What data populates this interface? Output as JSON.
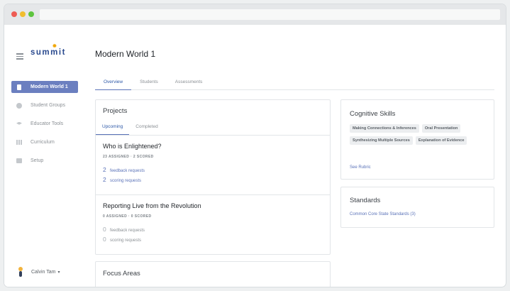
{
  "app": {
    "logo_text": "summit"
  },
  "sidebar": {
    "items": [
      {
        "label": "Modern World 1",
        "icon": "book-icon",
        "active": true
      },
      {
        "label": "Student Groups",
        "icon": "person-icon",
        "active": false
      },
      {
        "label": "Educator Tools",
        "icon": "graduation-cap-icon",
        "active": false
      },
      {
        "label": "Curriculum",
        "icon": "grid-icon",
        "active": false
      },
      {
        "label": "Setup",
        "icon": "briefcase-icon",
        "active": false
      }
    ],
    "user": {
      "name": "Calvin Tam",
      "caret": "▾"
    }
  },
  "main": {
    "title": "Modern World 1",
    "tabs": [
      {
        "label": "Overview",
        "active": true
      },
      {
        "label": "Students",
        "active": false
      },
      {
        "label": "Assessments",
        "active": false
      }
    ]
  },
  "projects": {
    "title": "Projects",
    "tabs": [
      {
        "label": "Upcoming",
        "active": true
      },
      {
        "label": "Completed",
        "active": false
      }
    ],
    "items": [
      {
        "title": "Who is Enlightened?",
        "meta": "23 ASSIGNED · 2 SCORED",
        "feedback_count": "2",
        "feedback_label": "feedback requests",
        "scoring_count": "2",
        "scoring_label": "scoring requests"
      },
      {
        "title": "Reporting Live from the Revolution",
        "meta": "0 ASSIGNED · 0 SCORED",
        "feedback_count": "0",
        "feedback_label": "feedback requests",
        "scoring_count": "0",
        "scoring_label": "scoring requests"
      }
    ]
  },
  "focus_areas": {
    "title": "Focus Areas"
  },
  "cognitive_skills": {
    "title": "Cognitive Skills",
    "chips": [
      "Making Connections & Inferences",
      "Oral Presentation",
      "Synthesizing Multiple Sources",
      "Explanation of Evidence"
    ],
    "link": "See Rubric"
  },
  "standards": {
    "title": "Standards",
    "link": "Common Core State Standards (3)"
  },
  "colors": {
    "accent": "#6b7fc0",
    "link": "#5a72b8",
    "logo": "#2a4a8f"
  }
}
